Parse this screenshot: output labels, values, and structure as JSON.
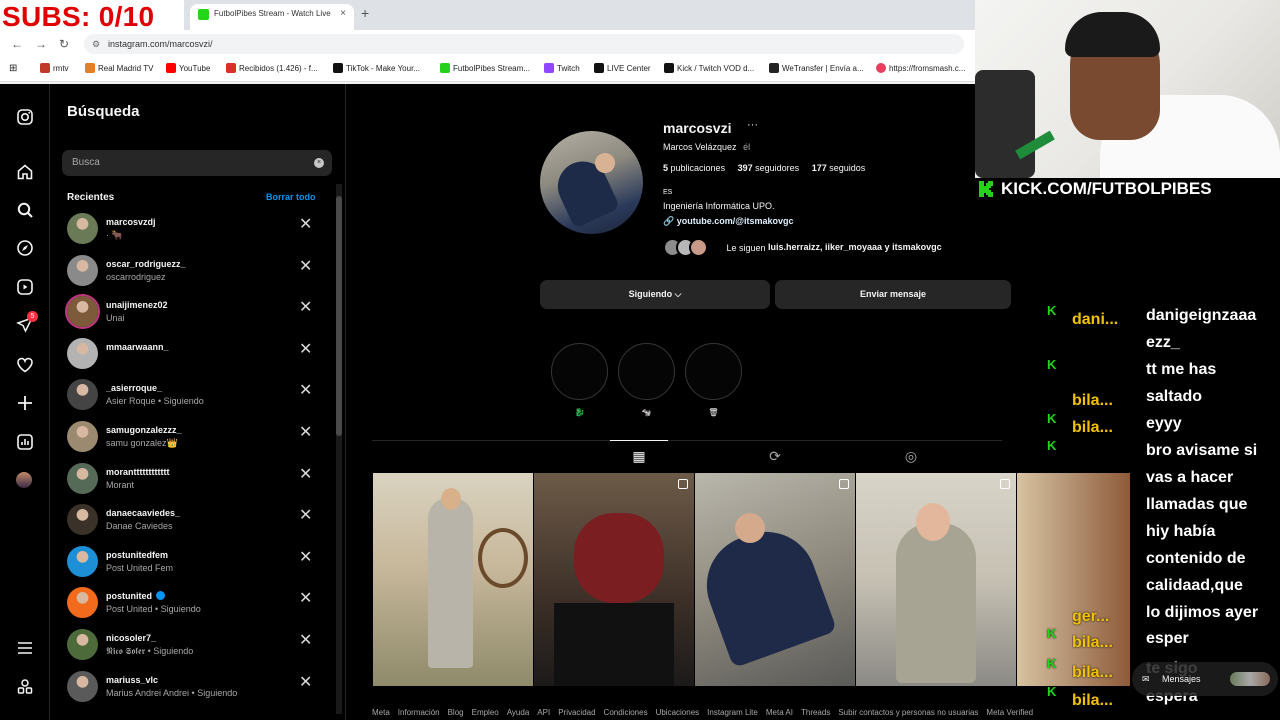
{
  "overlay": {
    "subs_text": "SUBS: 0/10",
    "kick_url": "KICK.COM/FUTBOLPIBES",
    "kick_color": "#25d11a"
  },
  "browser": {
    "tab_title": "FutbolPibes Stream - Watch Live",
    "tab_close": "×",
    "new_tab": "+",
    "url": "instagram.com/marcosvzi/",
    "bookmarks": [
      {
        "label": "rmtv",
        "color": "#c0392b"
      },
      {
        "label": "Real Madrid TV",
        "color": "#e67e22"
      },
      {
        "label": "YouTube",
        "color": "#ff0000"
      },
      {
        "label": "Recibidos (1.426) - f...",
        "color": "#d93025"
      },
      {
        "label": "TikTok - Make Your...",
        "color": "#111111"
      },
      {
        "label": "FutbolPibes Stream...",
        "color": "#25d11a"
      },
      {
        "label": "Twitch",
        "color": "#9146ff"
      },
      {
        "label": "LIVE Center",
        "color": "#111111"
      },
      {
        "label": "Kick / Twitch VOD d...",
        "color": "#111111"
      },
      {
        "label": "WeTransfer | Envía a...",
        "color": "#222222"
      },
      {
        "label": "https://fromsmash.c...",
        "color": "#e4405f"
      }
    ]
  },
  "search": {
    "title": "Búsqueda",
    "placeholder": "Busca",
    "clear_icon": "×",
    "recent_label": "Recientes",
    "clear_all": "Borrar todo",
    "remove_icon": "✕",
    "items": [
      {
        "name": "marcosvzdj",
        "sub": "· 🐂",
        "avatar_color": "#6b7a56"
      },
      {
        "name": "oscar_rodriguezz_",
        "sub": "oscarrodriguez",
        "avatar_color": "#8a8a8a"
      },
      {
        "name": "unaijimenez02",
        "sub": "Unai",
        "avatar_color": "#7c5a3a",
        "ring": true
      },
      {
        "name": "mmaarwaann_",
        "sub": "",
        "avatar_color": "#b3b3b3"
      },
      {
        "name": "_asierroque_",
        "sub": "Asier Roque • Siguiendo",
        "avatar_color": "#444444"
      },
      {
        "name": "samugonzalezzz_",
        "sub": "samu gonzalez👑",
        "avatar_color": "#9c8a70"
      },
      {
        "name": "morantttttttttttt",
        "sub": "Morant",
        "avatar_color": "#556b57"
      },
      {
        "name": "danaecaaviedes_",
        "sub": "Danae Caviedes",
        "avatar_color": "#3a3128"
      },
      {
        "name": "postunitedfem",
        "sub": "Post United Fem",
        "avatar_color": "#1d8fd6"
      },
      {
        "name": "postunited",
        "sub": "Post United • Siguiendo",
        "avatar_color": "#f26a1b",
        "verified": true
      },
      {
        "name": "nicosoler7_",
        "sub": "𝕹𝖎𝖈𝖔 𝕾𝖔𝖑𝖊𝖗 • Siguiendo",
        "avatar_color": "#4d6b3a"
      },
      {
        "name": "mariuss_vlc",
        "sub": "Marius Andrei Andrei • Siguiendo",
        "avatar_color": "#5a5a5a"
      }
    ]
  },
  "profile": {
    "username": "marcosvzi",
    "more": "···",
    "full_name": "Marcos Velázquez",
    "pronoun": "él",
    "posts_count": "5",
    "posts_label": "publicaciones",
    "followers_count": "397",
    "followers_label": "seguidores",
    "following_count": "177",
    "following_label": "seguidos",
    "lang": "ES",
    "bio": "Ingeniería Informática UPO.",
    "link": "youtube.com/@itsmakovgc",
    "followed_by_prefix": "Le siguen ",
    "followed_by": "luis.herraizz, iiker_moyaaa y itsmakovgc",
    "following_button": "Siguiendo ⌵",
    "message_button": "Enviar mensaje",
    "highlights": [
      "🐉",
      "🐄",
      "🗑"
    ]
  },
  "tabs": {
    "posts_icon": "▦",
    "reels_icon": "⟳",
    "tagged_icon": "◎"
  },
  "footer": [
    "Meta",
    "Información",
    "Blog",
    "Empleo",
    "Ayuda",
    "API",
    "Privacidad",
    "Condiciones",
    "Ubicaciones",
    "Instagram Lite",
    "Meta AI",
    "Threads",
    "Subir contactos y personas no usuarias",
    "Meta Verified"
  ],
  "chat": [
    {
      "user": "dani...",
      "text": "danigeignzaaa"
    },
    {
      "user": "",
      "text": "ezz_"
    },
    {
      "user": "bila...",
      "text": "tt me has\nsaltado"
    },
    {
      "user": "bila...",
      "text": "eyyy"
    },
    {
      "user": "ger...",
      "text": "bro avisame si\nvas a hacer\nllamadas que\nhiy había\ncontenido de\ncalidaad,que\nlo dijimos ayer"
    },
    {
      "user": "bila...",
      "text": "esper"
    },
    {
      "user": "bila...",
      "text": "te sigo"
    },
    {
      "user": "bila...",
      "text": "espera"
    }
  ],
  "messages_pill": "Mensajes"
}
